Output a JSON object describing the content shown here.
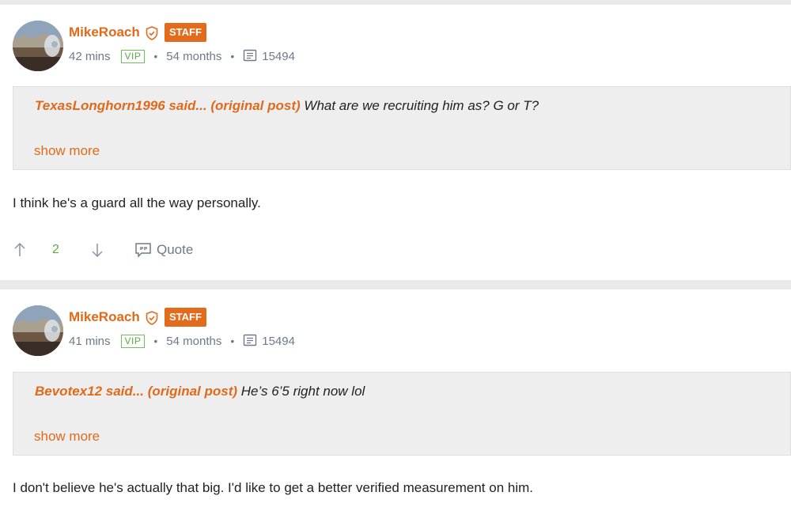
{
  "colors": {
    "accent": "#e06a1b",
    "vip": "#5aaa45",
    "meta": "#6e7a8a"
  },
  "posts": [
    {
      "author": "MikeRoach",
      "badge": "STAFF",
      "time": "42 mins",
      "tier": "VIP",
      "tenure": "54 months",
      "post_count": "15494",
      "quote": {
        "author": "TexasLonghorn1996 said...",
        "open_paren": "(",
        "link": "original post",
        "close_paren": ")",
        "text": " What are we recruiting him as? G or T?"
      },
      "show_more": "show more",
      "body": "I think he's a guard all the way personally.",
      "votes": "2",
      "quote_label": "Quote"
    },
    {
      "author": "MikeRoach",
      "badge": "STAFF",
      "time": "41 mins",
      "tier": "VIP",
      "tenure": "54 months",
      "post_count": "15494",
      "quote": {
        "author": "Bevotex12 said...",
        "open_paren": "(",
        "link": "original post",
        "close_paren": ")",
        "text": " He’s 6’5 right now lol"
      },
      "show_more": "show more",
      "body": "I don't believe he's actually that big. I'd like to get a better verified measurement on him."
    }
  ],
  "icons": {
    "verified": "shield-check-icon",
    "posts": "message-icon",
    "upvote": "arrow-up-icon",
    "downvote": "arrow-down-icon",
    "quote": "quote-bubble-icon"
  },
  "separator": "•"
}
